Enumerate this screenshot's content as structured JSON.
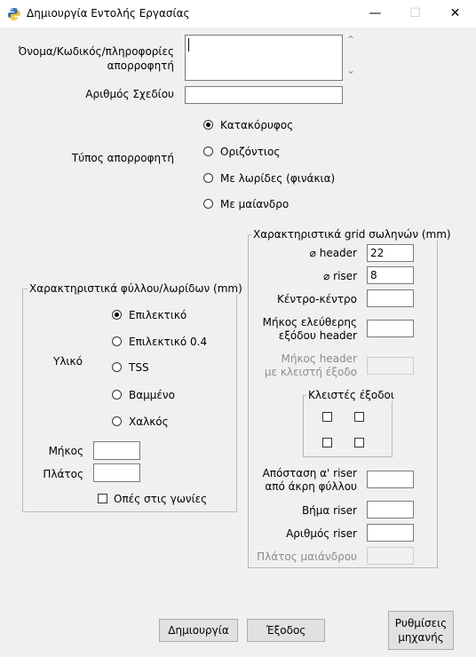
{
  "window": {
    "title": "Δημιουργία Εντολής Εργασίας",
    "minimize_glyph": "—",
    "maximize_glyph": "☐",
    "close_glyph": "✕"
  },
  "top": {
    "receiver_info_label_line1": "Όνομα/Κωδικός/πληροφορίες",
    "receiver_info_label_line2": "απορροφητή",
    "receiver_info_value": "",
    "scroll_up_glyph": "⌃",
    "scroll_down_glyph": "⌄",
    "drawing_number_label": "Αριθμός Σχεδίου",
    "drawing_number_value": "",
    "receiver_type_label": "Τύπος απορροφητή",
    "receiver_type_options": [
      "Κατακόρυφος",
      "Οριζόντιος",
      "Με λωρίδες (φινάκια)",
      "Με μαίανδρο"
    ],
    "receiver_type_selected": "Κατακόρυφος"
  },
  "sheet_group": {
    "title": "Χαρακτηριστικά φύλλου/λωρίδων (mm)",
    "material_label": "Υλικό",
    "material_options": [
      "Επιλεκτικό",
      "Επιλεκτικό 0.4",
      "TSS",
      "Βαμμένο",
      "Χαλκός"
    ],
    "material_selected": "Επιλεκτικό",
    "length_label": "Μήκος",
    "length_value": "",
    "width_label": "Πλάτος",
    "width_value": "",
    "corner_holes_label": "Οπές στις γωνίες",
    "corner_holes_checked": false
  },
  "grid_group": {
    "title": "Χαρακτηριστικά grid σωληνών (mm)",
    "header_label": "⌀ header",
    "header_value": "22",
    "riser_label": "⌀ riser",
    "riser_value": "8",
    "center_label": "Κέντρο-κέντρο",
    "center_value": "",
    "free_exit_label_line1": "Μήκος ελεύθερης",
    "free_exit_label_line2": "εξόδου header",
    "free_exit_value": "",
    "closed_exit_label_line1": "Μήκος header",
    "closed_exit_label_line2": "με κλειστή έξοδο",
    "closed_exit_value": "",
    "closed_exits_title": "Κλειστές έξοδοι",
    "first_riser_label_line1": "Απόσταση α' riser",
    "first_riser_label_line2": "από άκρη φύλλου",
    "first_riser_value": "",
    "riser_pitch_label": "Βήμα riser",
    "riser_pitch_value": "",
    "riser_count_label": "Αριθμός riser",
    "riser_count_value": "",
    "meander_width_label": "Πλάτος μαιάνδρου",
    "meander_width_value": ""
  },
  "buttons": {
    "create": "Δημιουργία",
    "exit": "Έξοδος",
    "machine_settings_line1": "Ρυθμίσεις",
    "machine_settings_line2": "μηχανής"
  }
}
